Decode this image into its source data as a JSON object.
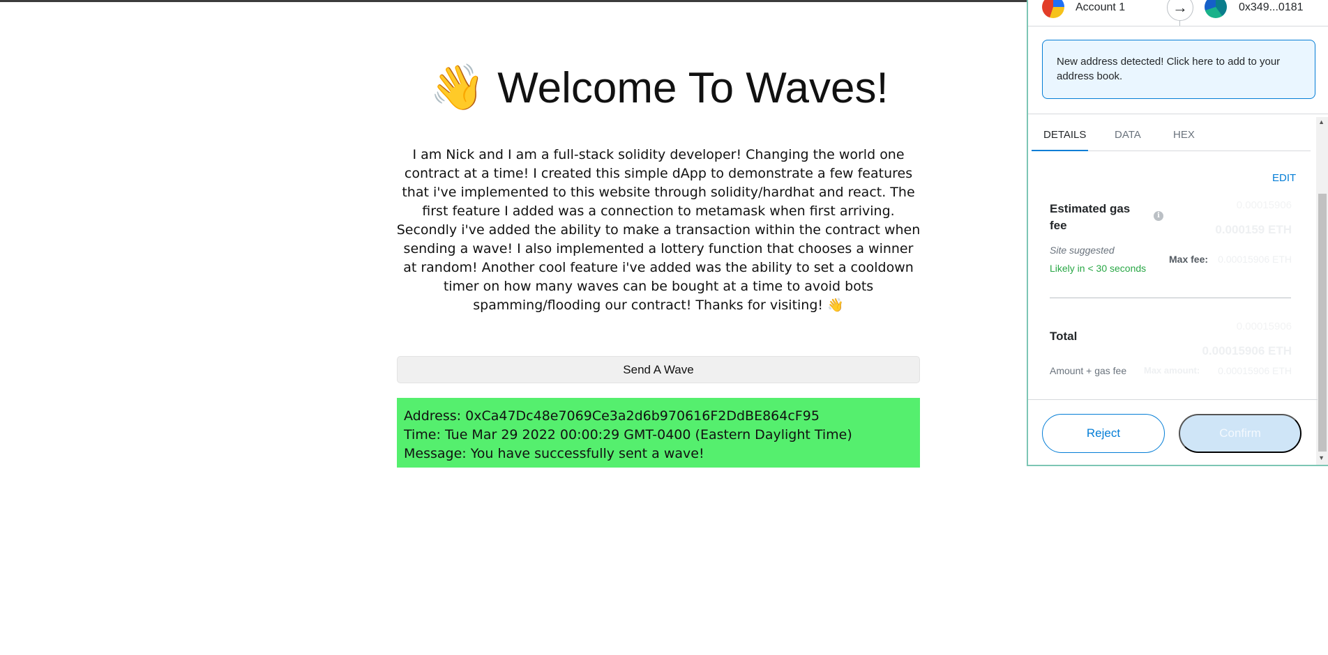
{
  "page": {
    "title": "Welcome To Waves!",
    "title_emoji": "👋",
    "description": "I am Nick and I am a full-stack solidity developer! Changing the world one contract at a time! I created this simple dApp to demonstrate a few features that i've implemented to this website through solidity/hardhat and react. The first feature I added was a connection to metamask when first arriving. Secondly i've added the ability to make a transaction within the contract when sending a wave! I also implemented a lottery function that chooses a winner at random! Another cool feature i've added was the ability to set a cooldown timer on how many waves can be bought at a time to avoid bots spamming/flooding our contract! Thanks for visiting! 👋",
    "wave_button": "Send A Wave",
    "wave_card": {
      "address": "Address: 0xCa47Dc48e7069Ce3a2d6b970616F2DdBE864cF95",
      "time": "Time: Tue Mar 29 2022 00:00:29 GMT-0400 (Eastern Daylight Time)",
      "message": "Message: You have successfully sent a wave!"
    },
    "card_color": "#55ef6e"
  },
  "metamask": {
    "from_account": "Account 1",
    "to_address": "0x349...0181",
    "notice": "New address detected! Click here to add to your address book.",
    "tabs": [
      "DETAILS",
      "DATA",
      "HEX"
    ],
    "active_tab": "DETAILS",
    "edit": "EDIT",
    "gas_label": "Estimated gas fee",
    "gas_secondary": "0.00015906",
    "gas_primary": "0.000159 ETH",
    "site_suggested": "Site suggested",
    "likely": "Likely in < 30 seconds",
    "max_fee_label": "Max fee:",
    "max_fee_value": "0.00015906 ETH",
    "total_label": "Total",
    "total_secondary": "0.00015906",
    "total_primary": "0.00015906 ETH",
    "amount_gas": "Amount + gas fee",
    "max_amount_label": "Max amount:",
    "max_amount_value": "0.00015906 ETH",
    "reject": "Reject",
    "confirm": "Confirm",
    "accent_color": "#037dd6",
    "success_color": "#28a745"
  }
}
